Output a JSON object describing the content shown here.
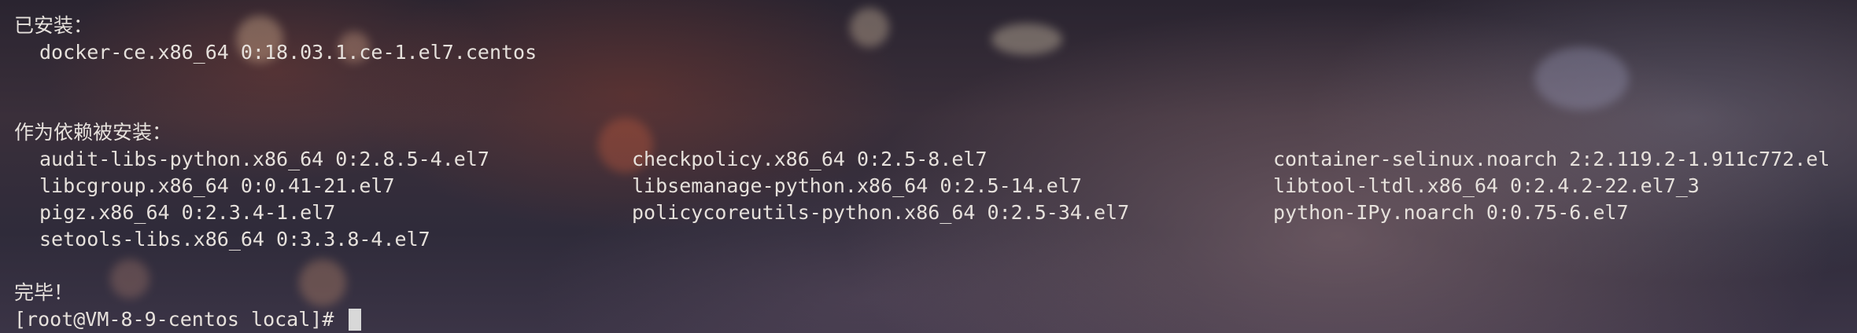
{
  "terminal": {
    "installed_header": "已安装：",
    "installed_package": "docker-ce.x86_64 0:18.03.1.ce-1.el7.centos",
    "dependency_header": "作为依赖被安装：",
    "dependencies": [
      [
        "audit-libs-python.x86_64 0:2.8.5-4.el7",
        "checkpolicy.x86_64 0:2.5-8.el7",
        "container-selinux.noarch 2:2.119.2-1.911c772.el"
      ],
      [
        "libcgroup.x86_64 0:0.41-21.el7",
        "libsemanage-python.x86_64 0:2.5-14.el7",
        "libtool-ltdl.x86_64 0:2.4.2-22.el7_3"
      ],
      [
        "pigz.x86_64 0:2.3.4-1.el7",
        "policycoreutils-python.x86_64 0:2.5-34.el7",
        "python-IPy.noarch 0:0.75-6.el7"
      ],
      [
        "setools-libs.x86_64 0:3.3.8-4.el7",
        "",
        ""
      ]
    ],
    "done_text": "完毕！",
    "prompt": "[root@VM-8-9-centos local]# "
  },
  "colors": {
    "text": "#e6e1dc",
    "cursor": "#d8d8d8"
  }
}
